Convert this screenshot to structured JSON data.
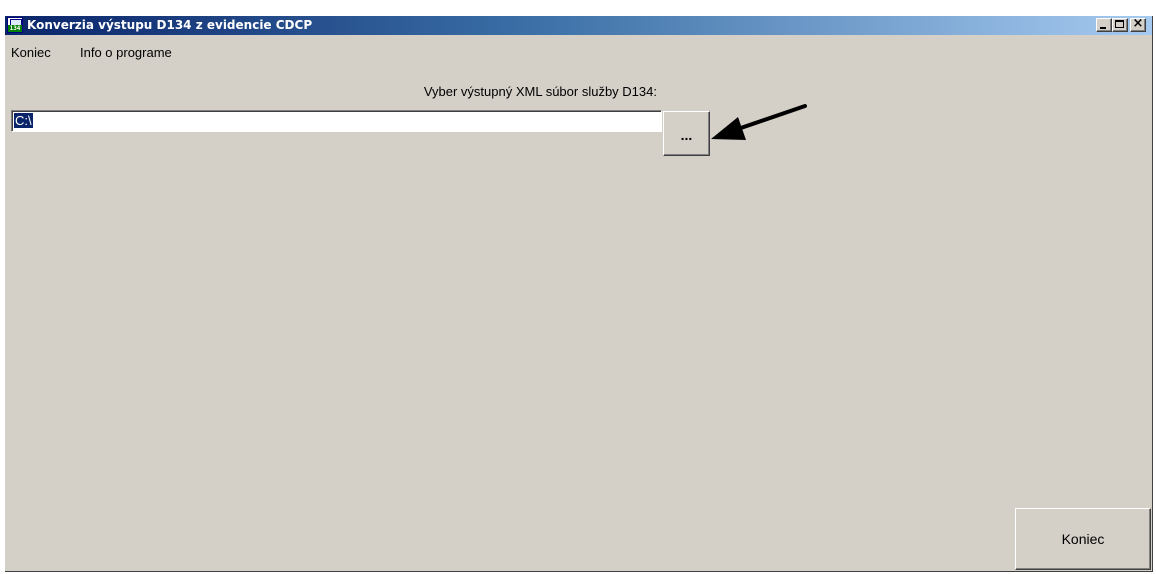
{
  "window": {
    "title": "Konverzia výstupu D134 z evidencie CDCP",
    "icon_text": "134",
    "icon": "app-icon"
  },
  "title_buttons": {
    "minimize": "minimize-icon",
    "maximize": "maximize-icon",
    "close": "close-icon",
    "close_glyph": "×"
  },
  "menu": {
    "items": [
      {
        "label": "Koniec"
      },
      {
        "label": "Info o programe"
      }
    ]
  },
  "form": {
    "file_label": "Vyber výstupný XML súbor služby D134:",
    "path_value": "C:\\",
    "browse_label": "..."
  },
  "footer": {
    "close_label": "Koniec"
  },
  "colors": {
    "window_bg": "#d4d0c8",
    "titlebar_start": "#0a246a",
    "titlebar_end": "#a6caf0",
    "selection": "#0a246a"
  },
  "annotation": {
    "icon": "arrow-pointer-icon"
  }
}
